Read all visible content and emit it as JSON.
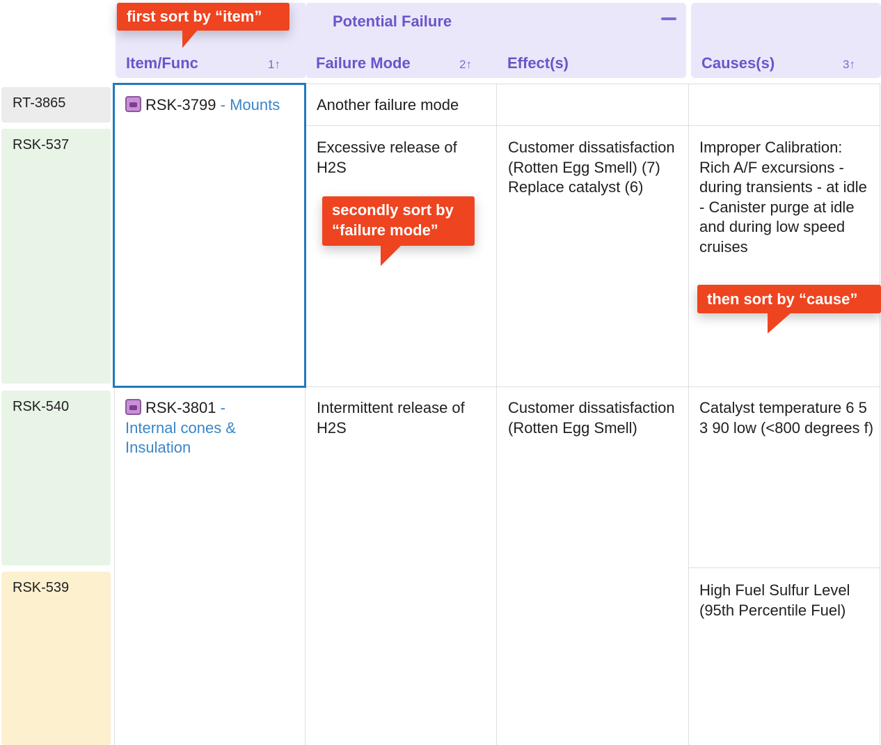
{
  "header": {
    "group_title": "Potential Failure",
    "columns": [
      {
        "label": "Item/Func",
        "sort": "1↑"
      },
      {
        "label": "Failure Mode",
        "sort": "2↑"
      },
      {
        "label": "Effect(s)",
        "sort": ""
      },
      {
        "label": "Causes(s)",
        "sort": "3↑"
      }
    ]
  },
  "row_keys": [
    "RT-3865",
    "RSK-537",
    "RSK-540",
    "RSK-539"
  ],
  "items": [
    {
      "id": "RSK-3799",
      "sep": " - ",
      "name": "Mounts"
    },
    {
      "id": "RSK-3801",
      "sep": " -",
      "name": "Internal cones & Insulation"
    }
  ],
  "cells": {
    "failure_mode_1": "Another failure mode",
    "failure_mode_2": "Excessive release of H2S",
    "failure_mode_3": "Intermittent release of H2S",
    "effect_2": "Customer dissatisfaction (Rotten Egg Smell) (7) Replace catalyst (6)",
    "effect_3": "Customer dissatisfaction (Rotten Egg Smell)",
    "cause_2": "Improper Calibration: Rich A/F excursions - during transients - at idle - Canister purge at idle and during low speed cruises",
    "cause_3": "Catalyst temperature 6 5 3 90 low (<800 degrees f)",
    "cause_4": "High Fuel Sulfur Level (95th Percentile Fuel)"
  },
  "callouts": {
    "item": "first sort by “item”",
    "failure_mode_line1": "secondly sort by",
    "failure_mode_line2": "“failure mode”",
    "cause": "then sort by “cause”"
  },
  "icons": {
    "item": "item-icon",
    "collapse": "collapse-icon",
    "sort": "sort-arrow-icon"
  },
  "colors": {
    "accent": "#6b55c9",
    "callout": "#ee4420",
    "link": "#3a85c8",
    "selection": "#1d7bbf"
  }
}
